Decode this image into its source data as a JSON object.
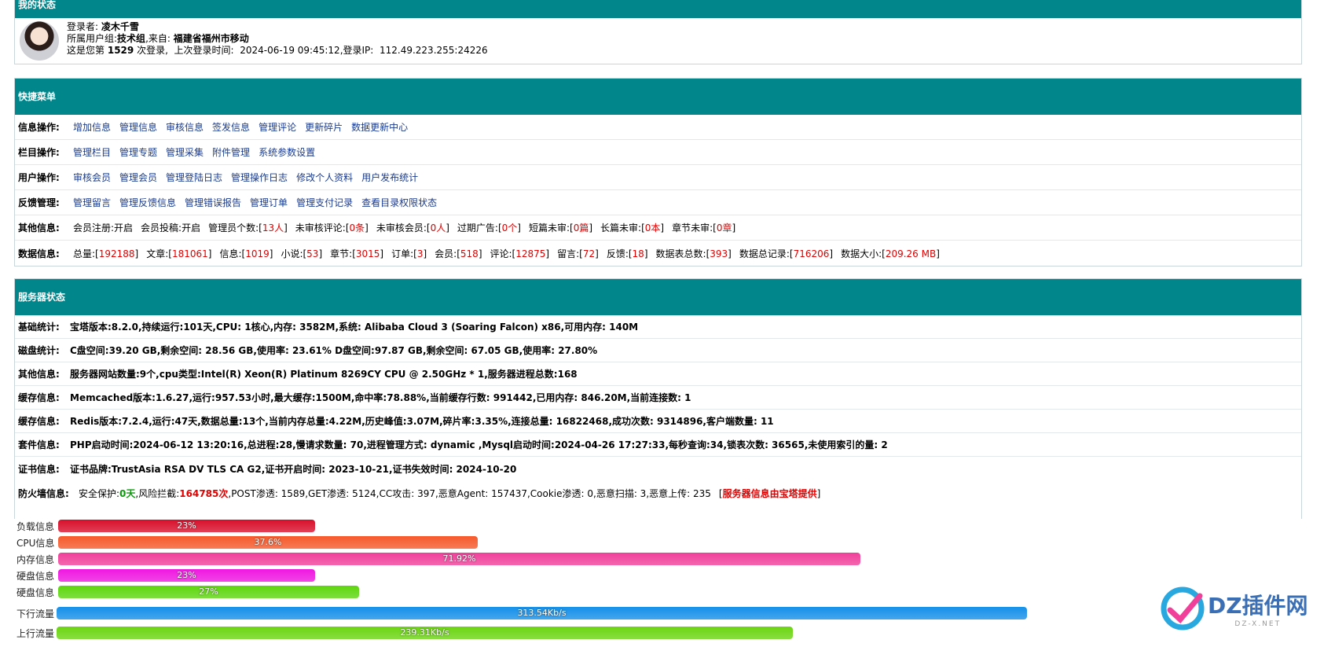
{
  "status_panel": {
    "title": "我的状态",
    "login_user_label": "登录者:",
    "login_user": "凌木千雪",
    "group_label": "所属用户组:",
    "group": "技术组",
    "from_label": "来自:",
    "from": "福建省福州市移动",
    "login_count_prefix": "这是您第",
    "login_count": "1529",
    "login_count_suffix": "次登录,",
    "last_login_label": "上次登录时间:",
    "last_login": "2024-06-19 09:45:12",
    "ip_label": "登录IP:",
    "ip": "112.49.223.255:24226"
  },
  "quick_menu": {
    "title": "快捷菜单",
    "rows": [
      {
        "label": "信息操作:",
        "links": [
          "增加信息",
          "管理信息",
          "审核信息",
          "签发信息",
          "管理评论",
          "更新碎片",
          "数据更新中心"
        ]
      },
      {
        "label": "栏目操作:",
        "links": [
          "管理栏目",
          "管理专题",
          "管理采集",
          "附件管理",
          "系统参数设置"
        ]
      },
      {
        "label": "用户操作:",
        "links": [
          "审核会员",
          "管理会员",
          "管理登陆日志",
          "管理操作日志",
          "修改个人资料",
          "用户发布统计"
        ]
      },
      {
        "label": "反馈管理:",
        "links": [
          "管理留言",
          "管理反馈信息",
          "管理错误报告",
          "管理订单",
          "管理支付记录",
          "查看目录权限状态"
        ]
      }
    ],
    "other": {
      "label": "其他信息:",
      "items": [
        {
          "k": "会员注册:开启",
          "v": ""
        },
        {
          "k": "会员投稿:开启",
          "v": ""
        },
        {
          "k": "管理员个数:",
          "v": "13人"
        },
        {
          "k": "未审核评论:",
          "v": "0条"
        },
        {
          "k": "未审核会员:",
          "v": "0人"
        },
        {
          "k": "过期广告:",
          "v": "0个"
        },
        {
          "k": "短篇未审:",
          "v": "0篇"
        },
        {
          "k": "长篇未审:",
          "v": "0本"
        },
        {
          "k": "章节未审:",
          "v": "0章"
        }
      ]
    },
    "data": {
      "label": "数据信息:",
      "items": [
        {
          "k": "总量:",
          "v": "192188"
        },
        {
          "k": "文章:",
          "v": "181061"
        },
        {
          "k": "信息:",
          "v": "1019"
        },
        {
          "k": "小说:",
          "v": "53"
        },
        {
          "k": "章节:",
          "v": "3015"
        },
        {
          "k": "订单:",
          "v": "3"
        },
        {
          "k": "会员:",
          "v": "518"
        },
        {
          "k": "评论:",
          "v": "12875"
        },
        {
          "k": "留言:",
          "v": "72"
        },
        {
          "k": "反馈:",
          "v": "18"
        },
        {
          "k": "数据表总数:",
          "v": "393"
        },
        {
          "k": "数据总记录:",
          "v": "716206"
        },
        {
          "k": "数据大小:",
          "v": "209.26 MB"
        }
      ]
    }
  },
  "server": {
    "title": "服务器状态",
    "rows": [
      {
        "label": "基础统计:",
        "text": "宝塔版本:8.2.0,持续运行:101天,CPU: 1核心,内存: 3582M,系统: Alibaba Cloud 3 (Soaring Falcon) x86,可用内存: 140M"
      },
      {
        "label": "磁盘统计:",
        "text": "C盘空间:39.20 GB,剩余空间: 28.56 GB,使用率: 23.61%      D盘空间:97.87 GB,剩余空间: 67.05 GB,使用率: 27.80%"
      },
      {
        "label": "其他信息:",
        "text": "服务器网站数量:9个,cpu类型:Intel(R) Xeon(R) Platinum 8269CY CPU @ 2.50GHz * 1,服务器进程总数:168"
      },
      {
        "label": "缓存信息:",
        "text": "Memcached版本:1.6.27,运行:957.53小时,最大缓存:1500M,命中率:78.88%,当前缓存行数: 991442,已用内存: 846.20M,当前连接数: 1"
      },
      {
        "label": "缓存信息:",
        "text": "Redis版本:7.2.4,运行:47天,数据总量:13个,当前内存总量:4.22M,历史峰值:3.07M,碎片率:3.35%,连接总量: 16822468,成功次数: 9314896,客户端数量: 11"
      },
      {
        "label": "套件信息:",
        "text": "PHP启动时间:2024-06-12 13:20:16,总进程:28,慢请求数量: 70,进程管理方式: dynamic ,Mysql启动时间:2024-04-26 17:27:33,每秒查询:34,锁表次数: 36565,未使用索引的量: 2"
      },
      {
        "label": "证书信息:",
        "text": "证书品牌:TrustAsia RSA DV TLS CA G2,证书开启时间: 2023-10-21,证书失效时间: 2024-10-20"
      }
    ],
    "firewall": {
      "label": "防火墙信息:",
      "safe_prefix": "安全保护:",
      "safe_days": "0天",
      "block_prefix": ",风险拦截:",
      "block": "164785次",
      "rest": ",POST渗透: 1589,GET渗透: 5124,CC攻击: 397,恶意Agent: 157437,Cookie渗透: 0,恶意扫描: 3,恶意上传: 235",
      "note": "服务器信息由宝塔提供"
    },
    "bars": [
      {
        "label": "负载信息",
        "text": "23%",
        "fraction": 0.23,
        "color": "#d8102c"
      },
      {
        "label": "CPU信息",
        "text": "37.6%",
        "fraction": 0.376,
        "color": "#f55a2c"
      },
      {
        "label": "内存信息",
        "text": "71.92%",
        "fraction": 0.7192,
        "color": "#f0409a"
      },
      {
        "label": "硬盘信息",
        "text": "23%",
        "fraction": 0.23,
        "color": "#ee18e0"
      },
      {
        "label": "硬盘信息",
        "text": "27%",
        "fraction": 0.27,
        "color": "#5ed60e"
      }
    ],
    "traffic": [
      {
        "label": "下行流量",
        "text": "313.54Kb/s",
        "fraction": 0.87,
        "color": "#1590e8"
      },
      {
        "label": "上行流量",
        "text": "239.31Kb/s",
        "fraction": 0.66,
        "color": "#6bd511"
      }
    ]
  },
  "watermark": {
    "logo": "DZ插件网",
    "sub": "DZ-X.NET"
  }
}
